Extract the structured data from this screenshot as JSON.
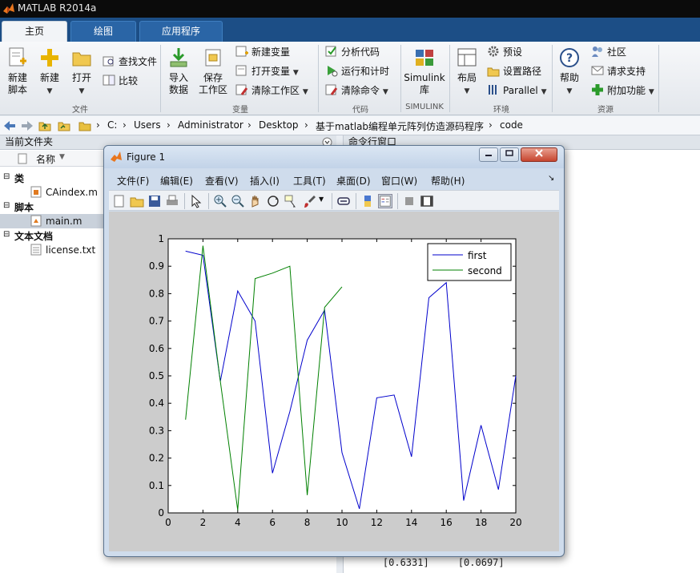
{
  "app": {
    "title": "MATLAB R2014a"
  },
  "tabs": [
    {
      "label": "主页",
      "active": true
    },
    {
      "label": "绘图",
      "active": false
    },
    {
      "label": "应用程序",
      "active": false
    }
  ],
  "ribbon": {
    "file_group": {
      "new_script": "新建\n脚本",
      "new": "新建",
      "open": "打开",
      "find_files": "查找文件",
      "compare": "比较",
      "label": "文件"
    },
    "variable_group": {
      "import": "导入\n数据",
      "save_ws": "保存\n工作区",
      "new_var": "新建变量",
      "open_var": "打开变量",
      "clear_ws": "清除工作区",
      "label": "变量"
    },
    "code_group": {
      "analyze": "分析代码",
      "run_time": "运行和计时",
      "clear_cmd": "清除命令",
      "label": "代码"
    },
    "simulink_group": {
      "simulink": "Simulink\n库",
      "label": "SIMULINK"
    },
    "env_group": {
      "layout": "布局",
      "prefs": "预设",
      "set_path": "设置路径",
      "parallel": "Parallel",
      "label": "环境"
    },
    "resources_group": {
      "help": "帮助",
      "community": "社区",
      "support": "请求支持",
      "addons": "附加功能",
      "label": "资源"
    }
  },
  "address": {
    "crumbs": [
      "C:",
      "Users",
      "Administrator",
      "Desktop",
      "基于matlab编程单元阵列仿造源码程序",
      "code"
    ]
  },
  "current_folder": {
    "title": "当前文件夹",
    "name_col": "名称",
    "sections": [
      {
        "label": "类",
        "files": [
          "CAindex.m"
        ]
      },
      {
        "label": "脚本",
        "files": [
          "main.m"
        ]
      },
      {
        "label": "文本文档",
        "files": [
          "license.txt"
        ]
      }
    ]
  },
  "command_window": {
    "title": "命令行窗口",
    "last_line": "    [0.6331]     [0.0697]"
  },
  "figure": {
    "title": "Figure 1",
    "menus": [
      "文件(F)",
      "编辑(E)",
      "查看(V)",
      "插入(I)",
      "工具(T)",
      "桌面(D)",
      "窗口(W)",
      "帮助(H)"
    ]
  },
  "chart_data": {
    "type": "line",
    "xlim": [
      0,
      20
    ],
    "ylim": [
      0,
      1
    ],
    "xticks": [
      0,
      2,
      4,
      6,
      8,
      10,
      12,
      14,
      16,
      18,
      20
    ],
    "yticks": [
      0,
      0.1,
      0.2,
      0.3,
      0.4,
      0.5,
      0.6,
      0.7,
      0.8,
      0.9,
      1
    ],
    "legend_position": "top-right",
    "grid": false,
    "series": [
      {
        "name": "first",
        "color": "#0000cc",
        "x": [
          1,
          2,
          3,
          4,
          5,
          6,
          7,
          8,
          9,
          10,
          11,
          12,
          13,
          14,
          15,
          16,
          17,
          18,
          19,
          20
        ],
        "y": [
          0.955,
          0.94,
          0.48,
          0.81,
          0.7,
          0.145,
          0.37,
          0.63,
          0.74,
          0.22,
          0.015,
          0.42,
          0.43,
          0.205,
          0.785,
          0.84,
          0.045,
          0.32,
          0.085,
          0.5
        ]
      },
      {
        "name": "second",
        "color": "#008000",
        "x": [
          1,
          2,
          3,
          4,
          5,
          6,
          7,
          8,
          9,
          10
        ],
        "y": [
          0.34,
          0.975,
          0.48,
          0.01,
          0.855,
          0.875,
          0.9,
          0.065,
          0.75,
          0.825
        ]
      }
    ]
  }
}
